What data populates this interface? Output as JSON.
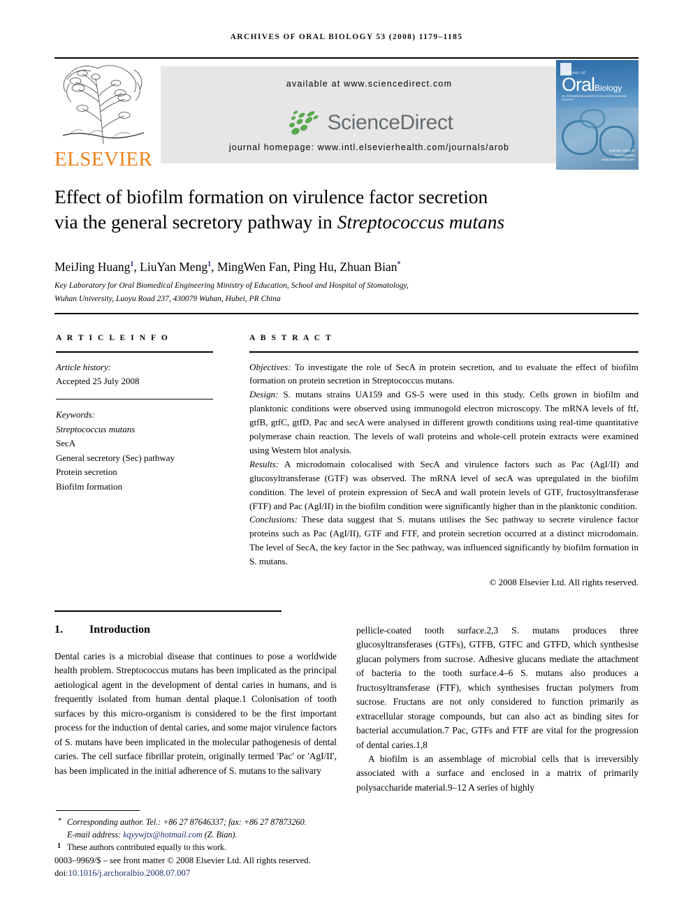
{
  "running_head": "Archives of Oral Biology 53 (2008) 1179–1185",
  "masthead": {
    "publisher_name": "ELSEVIER",
    "available_at": "available at www.sciencedirect.com",
    "sciencedirect_logo_text": "ScienceDirect",
    "journal_homepage": "journal homepage: www.intl.elsevierhealth.com/journals/arob",
    "cover": {
      "line1": "Archives of",
      "oral": "Oral",
      "biology": "Biology",
      "subtitle": "An international journal of oral and craniofacial sciences",
      "sciencedirect_badge": "available online at",
      "sciencedirect_badge2": "ScienceDirect",
      "sciencedirect_badge3": "www.sciencedirect.com"
    }
  },
  "article": {
    "title_line1": "Effect of biofilm formation on virulence factor secretion",
    "title_line2_pre": "via the general secretory pathway in ",
    "title_line2_italic": "Streptococcus mutans",
    "authors": "MeiJing Huang",
    "authors_full": "MeiJing Huang 1, LiuYan Meng 1, MingWen Fan, Ping Hu, Zhuan Bian *",
    "author_parts": [
      {
        "name": "MeiJing Huang",
        "sup": "1",
        "sep": ", "
      },
      {
        "name": "LiuYan Meng",
        "sup": "1",
        "sep": ", "
      },
      {
        "name": "MingWen Fan",
        "sup": "",
        "sep": ", "
      },
      {
        "name": "Ping Hu",
        "sup": "",
        "sep": ", "
      },
      {
        "name": "Zhuan Bian",
        "sup": "*",
        "sep": ""
      }
    ],
    "affiliation_line1": "Key Laboratory for Oral Biomedical Engineering Ministry of Education, School and Hospital of Stomatology,",
    "affiliation_line2": "Wuhan University, Luoyu Road 237, 430079 Wuhan, Hubei, PR China"
  },
  "article_info": {
    "heading": "A R T I C L E  I N F O",
    "history_label": "Article history:",
    "history_value": "Accepted 25 July 2008",
    "keywords_label": "Keywords:",
    "keywords": [
      "Streptococcus mutans",
      "SecA",
      "General secretory (Sec) pathway",
      "Protein secretion",
      "Biofilm formation"
    ]
  },
  "abstract": {
    "heading": "A B S T R A C T",
    "objectives_label": "Objectives:",
    "objectives_text": " To investigate the role of SecA in protein secretion, and to evaluate the effect of biofilm formation on protein secretion in Streptococcus mutans.",
    "design_label": "Design:",
    "design_text": " S. mutans strains UA159 and GS-5 were used in this study. Cells grown in biofilm and planktonic conditions were observed using immunogold electron microscopy. The mRNA levels of ftf, gtfB, gtfC, gtfD, Pac and secA were analysed in different growth conditions using real-time quantitative polymerase chain reaction. The levels of wall proteins and whole-cell protein extracts were examined using Western blot analysis.",
    "results_label": "Results:",
    "results_text": " A microdomain colocalised with SecA and virulence factors such as Pac (AgI/II) and glucosyltransferase (GTF) was observed. The mRNA level of secA was upregulated in the biofilm condition. The level of protein expression of SecA and wall protein levels of GTF, fructosyltransferase (FTF) and Pac (AgI/II) in the biofilm condition were significantly higher than in the planktonic condition.",
    "conclusions_label": "Conclusions:",
    "conclusions_text": " These data suggest that S. mutans utilises the Sec pathway to secrete virulence factor proteins such as Pac (AgI/II), GTF and FTF, and protein secretion occurred at a distinct microdomain. The level of SecA, the key factor in the Sec pathway, was influenced significantly by biofilm formation in S. mutans.",
    "copyright": "© 2008 Elsevier Ltd. All rights reserved."
  },
  "introduction": {
    "number": "1.",
    "heading": "Introduction",
    "left_paragraph": "Dental caries is a microbial disease that continues to pose a worldwide health problem. Streptococcus mutans has been implicated as the principal aetiological agent in the development of dental caries in humans, and is frequently isolated from human dental plaque.1 Colonisation of tooth surfaces by this micro-organism is considered to be the first important process for the induction of dental caries, and some major virulence factors of S. mutans have been implicated in the molecular pathogenesis of dental caries. The cell surface fibrillar protein, originally termed 'Pac' or 'AgI/II', has been implicated in the initial adherence of S. mutans to the salivary",
    "right_paragraph_1": "pellicle-coated tooth surface.2,3 S. mutans produces three glucosyltransferases (GTFs), GTFB, GTFC and GTFD, which synthesise glucan polymers from sucrose. Adhesive glucans mediate the attachment of bacteria to the tooth surface.4–6 S. mutans also produces a fructosyltransferase (FTF), which synthesises fructan polymers from sucrose. Fructans are not only considered to function primarily as extracellular storage compounds, but can also act as binding sites for bacterial accumulation.7 Pac, GTFs and FTF are vital for the progression of dental caries.1,8",
    "right_paragraph_2": "A biofilm is an assemblage of microbial cells that is irreversibly associated with a surface and enclosed in a matrix of primarily polysaccharide material.9–12 A series of highly"
  },
  "footer": {
    "corresponding_author": "Corresponding author. Tel.: +86 27 87646337; fax: +86 27 87873260.",
    "email_label": "E-mail address:",
    "email": "kqyywjtx@hotmail.com",
    "email_suffix": "(Z. Bian).",
    "equal_contribution": "These authors contributed equally to this work.",
    "front_matter": "0003–9969/$ – see front matter © 2008 Elsevier Ltd. All rights reserved.",
    "doi_label": "doi:",
    "doi_value": "10.1016/j.archoralbio.2008.07.007"
  },
  "colors": {
    "elsevier_orange": "#F07F1A",
    "sciencedirect_green": "#5aa84f",
    "sciencedirect_gray": "#666b6f",
    "link_navy": "#1a2f6b",
    "banner_gray": "#e6e6e6"
  }
}
